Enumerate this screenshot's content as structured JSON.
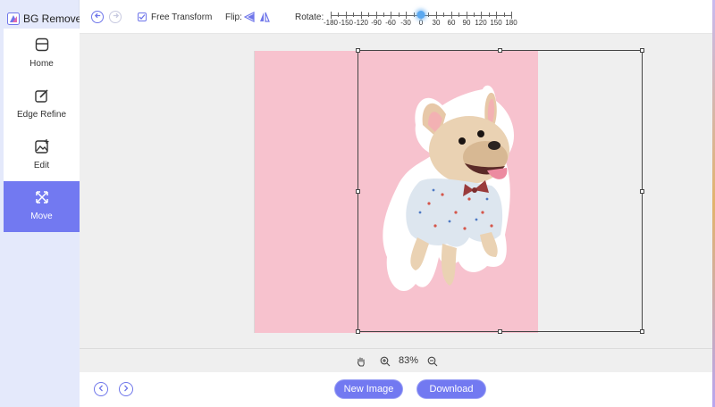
{
  "app": {
    "title": "BG Remover",
    "logo_icon": "bg-remover-logo-icon"
  },
  "sidebar": {
    "items": [
      {
        "label": "Home",
        "icon": "home-icon",
        "active": false
      },
      {
        "label": "Edge Refine",
        "icon": "pencil-square-icon",
        "active": false
      },
      {
        "label": "Edit",
        "icon": "image-edit-icon",
        "active": false
      },
      {
        "label": "Move",
        "icon": "move-arrows-icon",
        "active": true
      }
    ]
  },
  "toolbar": {
    "undo_icon": "undo-icon",
    "redo_icon": "redo-icon",
    "free_transform_label": "Free Transform",
    "free_transform_checked": true,
    "flip_label": "Flip:",
    "rotate_label": "Rotate:",
    "rotate_ticks": [
      "-180",
      "-150",
      "-120",
      "-90",
      "-60",
      "-30",
      "0",
      "30",
      "60",
      "90",
      "120",
      "150",
      "180"
    ],
    "rotate_value": 0
  },
  "zoom": {
    "value": "83%"
  },
  "bottom": {
    "new_image_label": "New Image",
    "download_label": "Download"
  },
  "colors": {
    "accent": "#7279f1",
    "photo_background": "#f7c2ce",
    "sidebar_bg": "#e4e9fb"
  }
}
